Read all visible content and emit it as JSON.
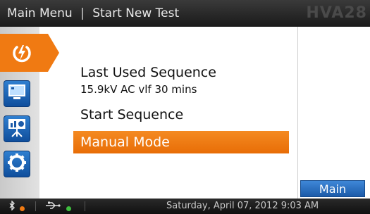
{
  "header": {
    "menu": "Main Menu",
    "separator": "|",
    "page": "Start New Test",
    "model": "HVA28"
  },
  "sidebar": {
    "items": [
      {
        "icon": "power-bolt-icon",
        "active": true
      },
      {
        "icon": "monitor-icon",
        "active": false
      },
      {
        "icon": "presentation-icon",
        "active": false
      },
      {
        "icon": "gear-icon",
        "active": false
      }
    ]
  },
  "main": {
    "last_used_label": "Last Used Sequence",
    "last_used_value": "15.9kV AC vlf 30 mins",
    "start_sequence": "Start Sequence",
    "manual_mode": "Manual Mode"
  },
  "buttons": {
    "main": "Main"
  },
  "status": {
    "bluetooth_icon": "bluetooth-icon",
    "usb_icon": "usb-icon",
    "datetime": "Saturday, April 07, 2012 9:03 AM"
  },
  "colors": {
    "accent_orange": "#f07a12",
    "sidebar_blue": "#1b5aa8",
    "bluetooth_dot": "#f07a12",
    "usb_dot": "#3fbf3f"
  }
}
